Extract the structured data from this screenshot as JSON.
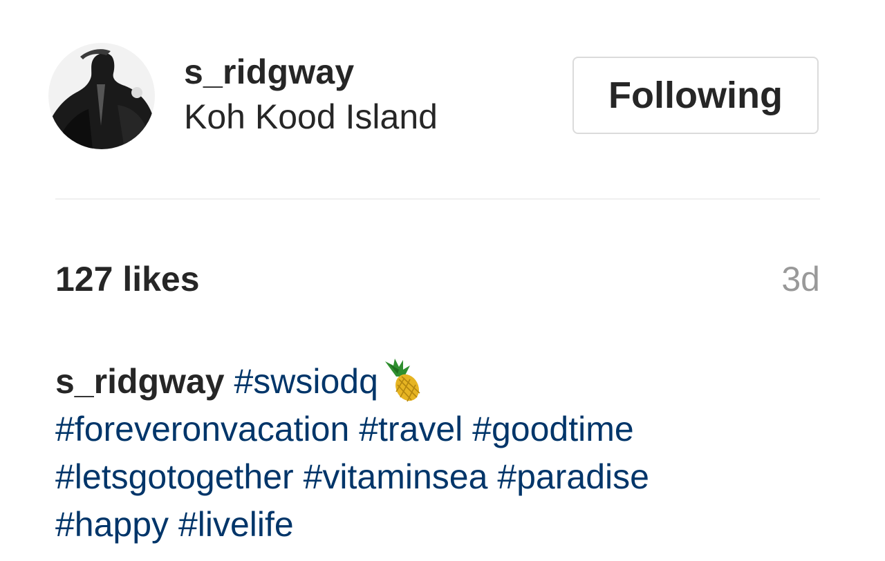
{
  "post_header": {
    "username": "s_ridgway",
    "location": "Koh Kood Island",
    "follow_button_label": "Following"
  },
  "post_meta": {
    "likes": "127 likes",
    "timestamp": "3d"
  },
  "caption": {
    "username": "s_ridgway",
    "first_tag": "#swsiodq",
    "emoji": "pineapple-icon",
    "tags": [
      "#foreveronvacation",
      "#travel",
      "#goodtime",
      "#letsgotogether",
      "#vitaminsea",
      "#paradise",
      "#happy",
      "#livelife"
    ]
  },
  "colors": {
    "text": "#262626",
    "hashtag": "#003569",
    "muted": "#999999",
    "border": "#dbdbdb"
  }
}
